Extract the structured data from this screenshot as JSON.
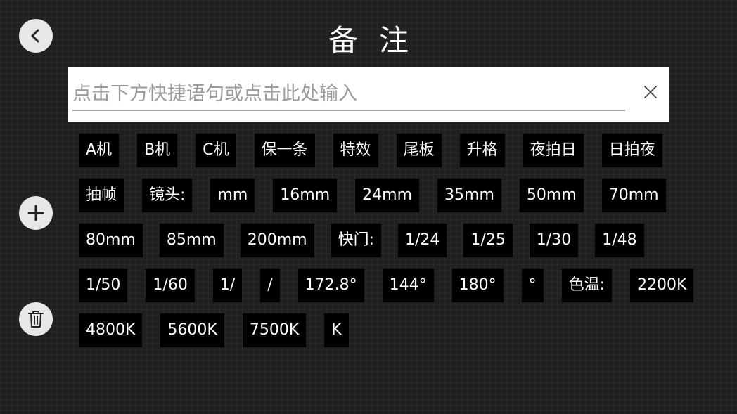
{
  "header": {
    "title": "备注"
  },
  "icons": {
    "back": "chevron-left-icon",
    "add": "plus-icon",
    "delete": "trash-icon",
    "clear": "close-icon"
  },
  "input": {
    "placeholder": "点击下方快捷语句或点击此处输入",
    "value": ""
  },
  "chips": {
    "rows": [
      [
        "A机",
        "B机",
        "C机",
        "保一条",
        "特效",
        "尾板",
        "升格",
        "夜拍日",
        "日拍夜"
      ],
      [
        "抽帧",
        "镜头:",
        "mm",
        "16mm",
        "24mm",
        "35mm",
        "50mm",
        "70mm"
      ],
      [
        "80mm",
        "85mm",
        "200mm",
        "快门:",
        "1/24",
        "1/25",
        "1/30",
        "1/48"
      ],
      [
        "1/50",
        "1/60",
        "1/",
        "/",
        "172.8°",
        "144°",
        "180°",
        "°",
        "色温:",
        "2200K"
      ],
      [
        "4800K",
        "5600K",
        "7500K",
        "K"
      ]
    ]
  },
  "colors": {
    "background": "#1f1f1f",
    "chip_bg": "#000000",
    "chip_text": "#ffffff",
    "icon_button": "#e7e7e7",
    "input_bg": "#ffffff"
  }
}
